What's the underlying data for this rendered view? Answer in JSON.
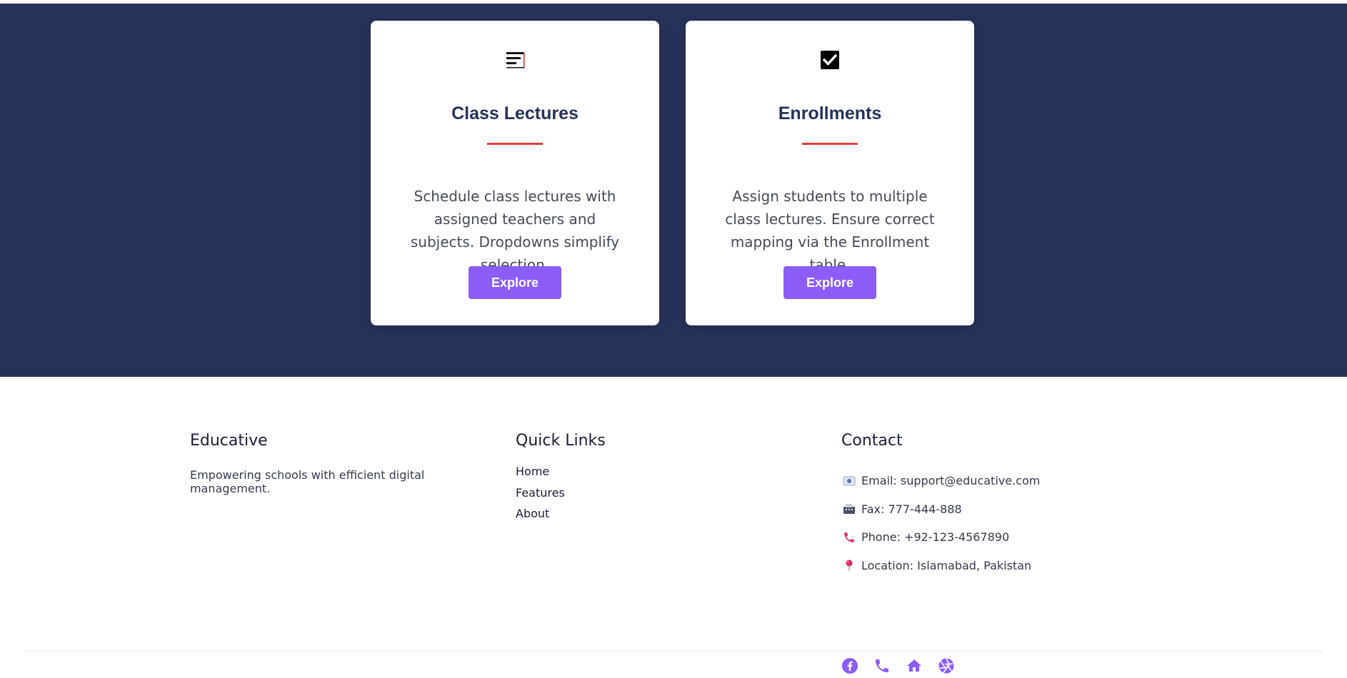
{
  "cards": [
    {
      "icon": "list-lines-icon",
      "title": "Class Lectures",
      "description": "Schedule class lectures with assigned teachers and subjects. Dropdowns simplify selection.",
      "button": "Explore"
    },
    {
      "icon": "checkbox-checked-icon",
      "title": "Enrollments",
      "description": "Assign students to multiple class lectures. Ensure correct mapping via the Enrollment table.",
      "button": "Explore"
    }
  ],
  "footer": {
    "brand": {
      "title": "Educative",
      "description": "Empowering schools with efficient digital management."
    },
    "quick_links": {
      "title": "Quick Links",
      "items": [
        "Home",
        "Features",
        "About"
      ]
    },
    "contact": {
      "title": "Contact",
      "items": [
        {
          "icon": "email-icon",
          "text": "Email: support@educative.com"
        },
        {
          "icon": "fax-icon",
          "text": "Fax: 777-444-888"
        },
        {
          "icon": "phone-icon",
          "text": "Phone: +92-123-4567890"
        },
        {
          "icon": "location-pin-icon",
          "text": "Location: Islamabad, Pakistan"
        }
      ],
      "socials": [
        "facebook-icon",
        "phone-icon",
        "home-icon",
        "aperture-icon"
      ]
    }
  },
  "colors": {
    "hero_bg": "#27325a",
    "accent": "#8b5cf6",
    "rule": "#e53e3e",
    "card_title": "#27325a"
  }
}
